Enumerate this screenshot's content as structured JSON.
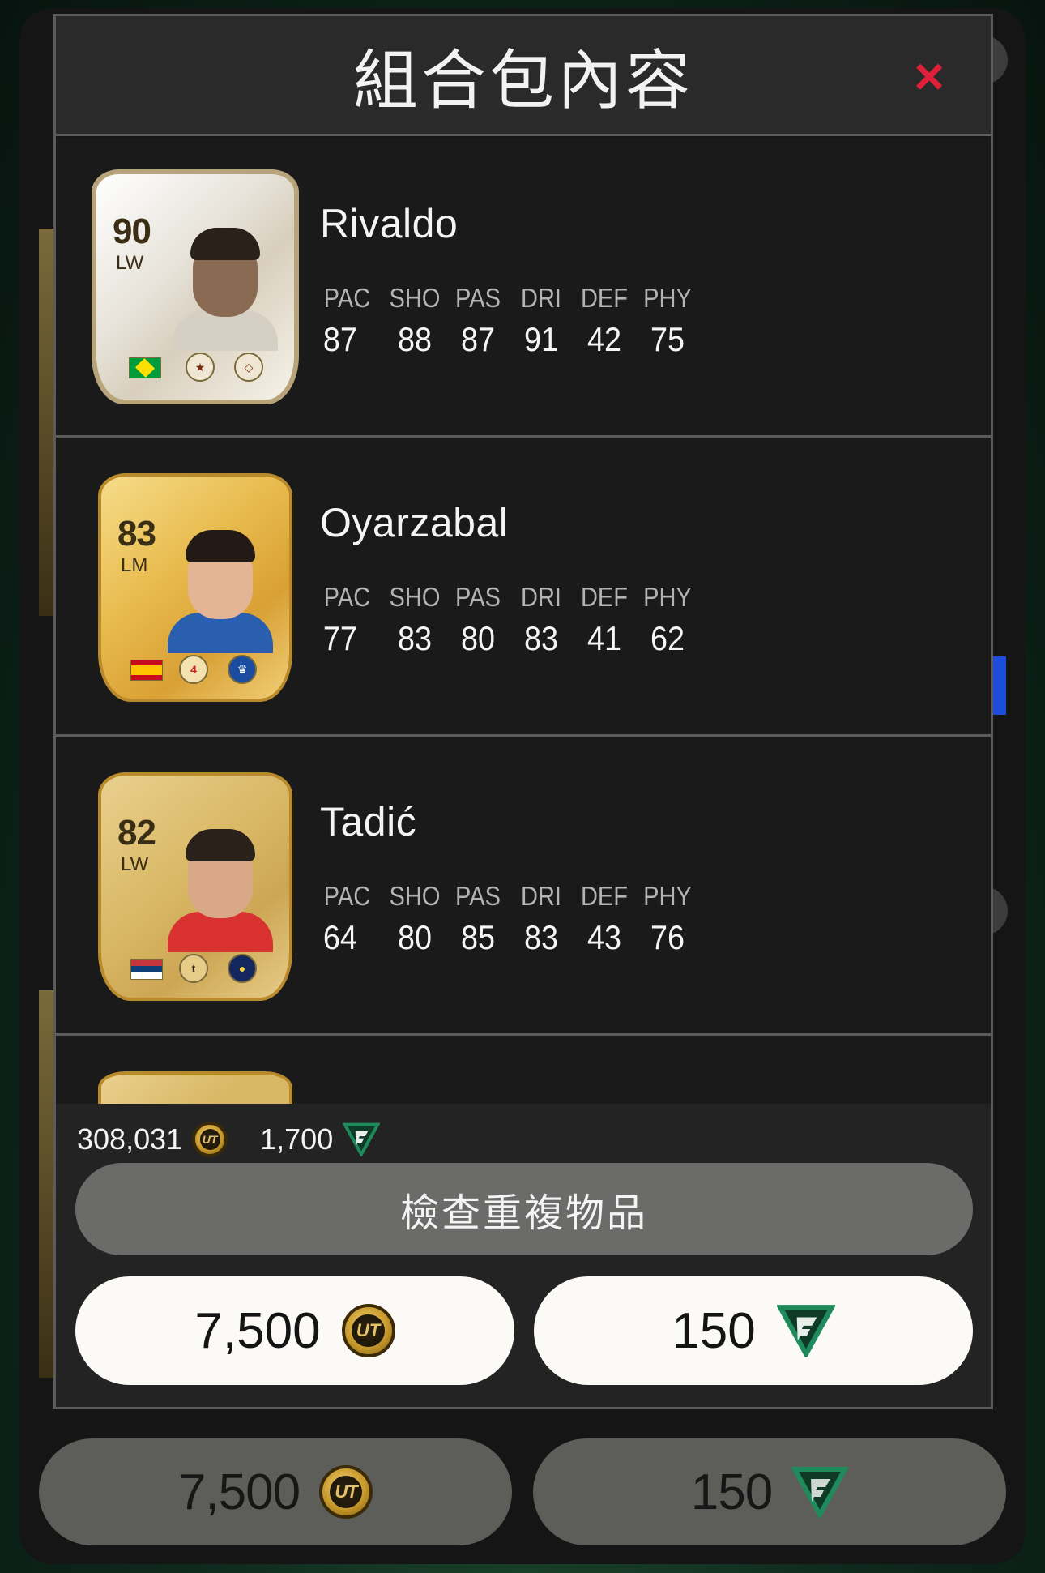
{
  "modal": {
    "title": "組合包內容",
    "close_label": "×"
  },
  "players": [
    {
      "name": "Rivaldo",
      "rating": "90",
      "position": "LW",
      "card_type": "icon",
      "flag": "brazil-flag",
      "stats": [
        {
          "label": "PAC",
          "value": "87"
        },
        {
          "label": "SHO",
          "value": "88"
        },
        {
          "label": "PAS",
          "value": "87"
        },
        {
          "label": "DRI",
          "value": "91"
        },
        {
          "label": "DEF",
          "value": "42"
        },
        {
          "label": "PHY",
          "value": "75"
        }
      ]
    },
    {
      "name": "Oyarzabal",
      "rating": "83",
      "position": "LM",
      "card_type": "gold",
      "flag": "spain-flag",
      "stats": [
        {
          "label": "PAC",
          "value": "77"
        },
        {
          "label": "SHO",
          "value": "83"
        },
        {
          "label": "PAS",
          "value": "80"
        },
        {
          "label": "DRI",
          "value": "83"
        },
        {
          "label": "DEF",
          "value": "41"
        },
        {
          "label": "PHY",
          "value": "62"
        }
      ]
    },
    {
      "name": "Tadić",
      "rating": "82",
      "position": "LW",
      "card_type": "gold-rare",
      "flag": "serbia-flag",
      "stats": [
        {
          "label": "PAC",
          "value": "64"
        },
        {
          "label": "SHO",
          "value": "80"
        },
        {
          "label": "PAS",
          "value": "85"
        },
        {
          "label": "DRI",
          "value": "83"
        },
        {
          "label": "DEF",
          "value": "43"
        },
        {
          "label": "PHY",
          "value": "76"
        }
      ]
    }
  ],
  "footer": {
    "coins": "308,031",
    "points": "1,700",
    "check_duplicates_label": "檢查重複物品",
    "buy_coins_label": "7,500",
    "buy_points_label": "150"
  },
  "background": {
    "buy_coins_label": "7,500",
    "buy_points_label": "150"
  },
  "icons": {
    "coin": "ut-coin-icon",
    "points": "fc-points-icon",
    "close": "close-icon"
  },
  "colors": {
    "close": "#e0203a",
    "modal_bg": "#161616",
    "header_bg": "#2a2a2a",
    "footer_bg": "#232323",
    "dup_button": "#6b6b69",
    "buy_button": "#fbfaf6",
    "points_green": "#1f8a5c"
  }
}
